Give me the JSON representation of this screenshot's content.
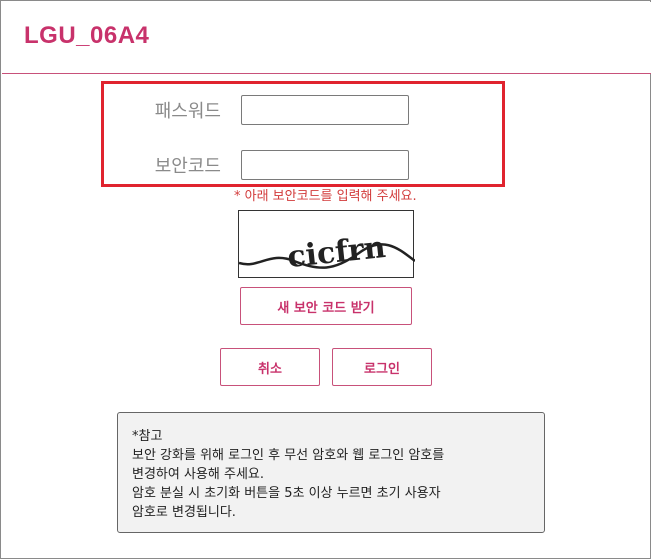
{
  "header": {
    "title": "LGU_06A4"
  },
  "login": {
    "password_label": "패스워드",
    "password_value": "",
    "security_label": "보안코드",
    "security_value": ""
  },
  "captcha": {
    "hint": "* 아래 보안코드를 입력해 주세요.",
    "text": "cicfrn",
    "refresh_label": "새 보안 코드 받기"
  },
  "actions": {
    "cancel_label": "취소",
    "login_label": "로그인"
  },
  "note": {
    "title": "*참고",
    "lines": [
      "보안 강화를 위해 로그인 후 무선 암호와 웹 로그인 암호를",
      "변경하여 사용해 주세요.",
      "암호 분실 시 초기화 버튼을 5초 이상 누르면 초기 사용자",
      "암호로 변경됩니다."
    ]
  },
  "colors": {
    "accent": "#c8326b",
    "highlight": "#e0232e",
    "hint": "#d23a3a"
  }
}
